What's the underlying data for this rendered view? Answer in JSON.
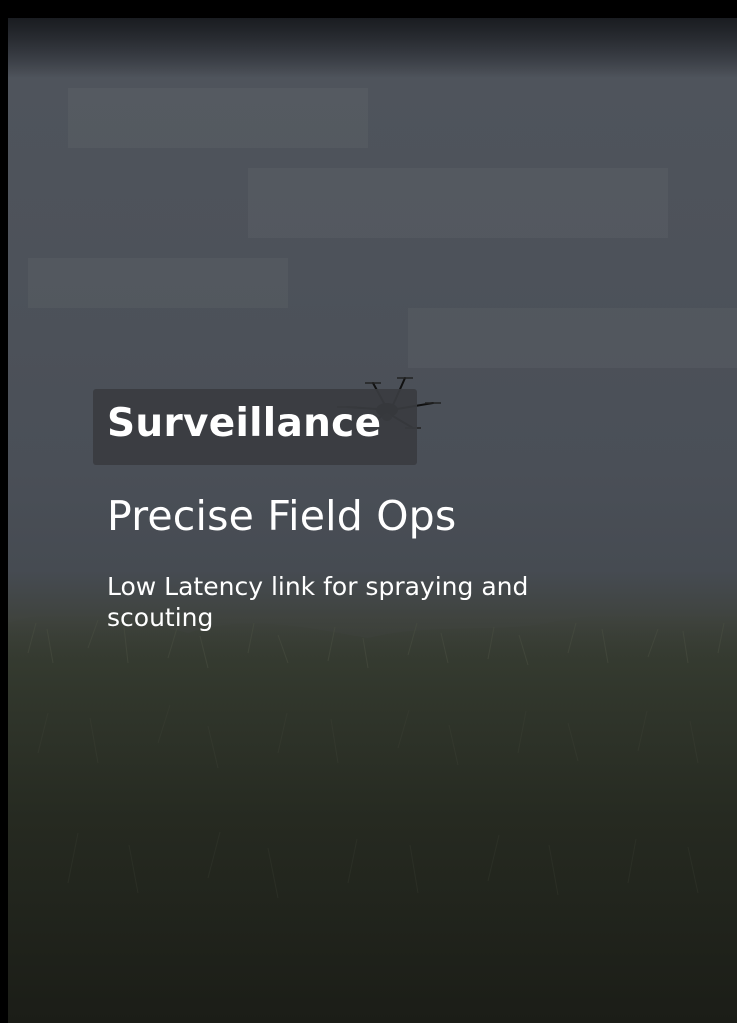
{
  "hero": {
    "category": "Surveillance",
    "headline": "Precise Field Ops",
    "description": "Low Latency link for spraying and scouting"
  },
  "colors": {
    "text": "#ffffff",
    "badge_background": "#3a3c40",
    "sky": "#4d525a",
    "grass": "#252820"
  },
  "icons": {
    "drone": "drone-icon"
  }
}
